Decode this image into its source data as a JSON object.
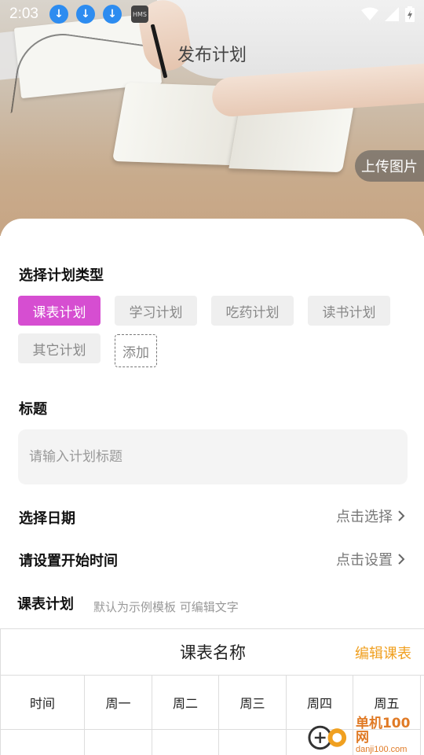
{
  "status_bar": {
    "time": "2:03",
    "icons": [
      "download-icon",
      "download-icon",
      "download-icon",
      "hms-icon",
      "wifi-icon",
      "signal-icon",
      "battery-icon"
    ]
  },
  "header": {
    "title": "发布计划",
    "upload_label": "上传图片"
  },
  "plan_type": {
    "label": "选择计划类型",
    "options": [
      "课表计划",
      "学习计划",
      "吃药计划",
      "读书计划",
      "其它计划"
    ],
    "selected": "课表计划",
    "add_label": "添加",
    "active_color": "#d64ed1"
  },
  "title_field": {
    "label": "标题",
    "placeholder": "请输入计划标题",
    "value": ""
  },
  "date_row": {
    "label": "选择日期",
    "action": "点击选择"
  },
  "time_row": {
    "label": "请设置开始时间",
    "action": "点击设置"
  },
  "schedule": {
    "label": "课表计划",
    "hint": "默认为示例模板 可编辑文字",
    "name": "课表名称",
    "edit_label": "编辑课表",
    "edit_color": "#f0a020",
    "columns": [
      "时间",
      "周一",
      "周二",
      "周三",
      "周四",
      "周五"
    ]
  },
  "watermark": {
    "cn": "单机100网",
    "en": "danji100.com"
  }
}
